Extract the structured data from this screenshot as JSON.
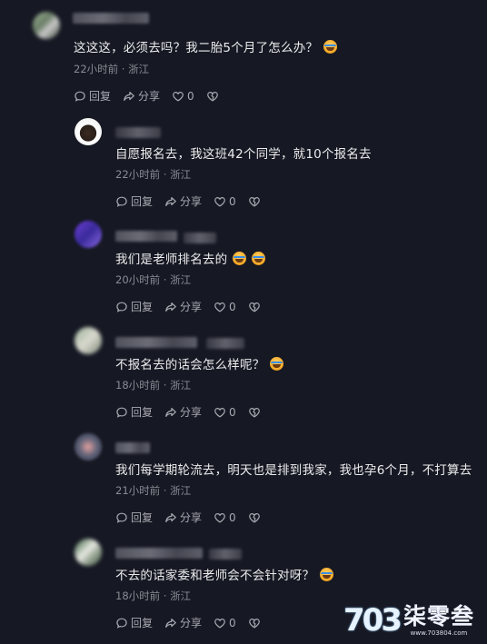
{
  "comments": [
    {
      "text": "这这这，必须去吗？我二胎5个月了怎么办？",
      "time": "22小时前 · 浙江",
      "reply": "回复",
      "share": "分享",
      "likes": "0"
    },
    {
      "text": "自愿报名去，我这班42个同学，就10个报名去",
      "time": "22小时前 · 浙江",
      "reply": "回复",
      "share": "分享",
      "likes": "0"
    },
    {
      "text": "我们是老师排名去的",
      "time": "20小时前 · 浙江",
      "reply": "回复",
      "share": "分享",
      "likes": "0"
    },
    {
      "text": "不报名去的话会怎么样呢？",
      "time": "18小时前 · 浙江",
      "reply": "回复",
      "share": "分享",
      "likes": "0"
    },
    {
      "text": "我们每学期轮流去，明天也是排到我家，我也孕6个月，不打算去",
      "time": "21小时前 · 浙江",
      "reply": "回复",
      "share": "分享",
      "likes": "0"
    },
    {
      "text": "不去的话家委和老师会不会针对呀？",
      "time": "18小时前 · 浙江",
      "reply": "回复",
      "share": "分享",
      "likes": "0"
    }
  ],
  "watermark": {
    "logo": "703",
    "name": "柒零叁",
    "url": "www.703804.com"
  },
  "colors": {
    "background": "#161823",
    "text": "#ececee",
    "meta": "#8a8b93",
    "action": "#a8a9b0"
  }
}
